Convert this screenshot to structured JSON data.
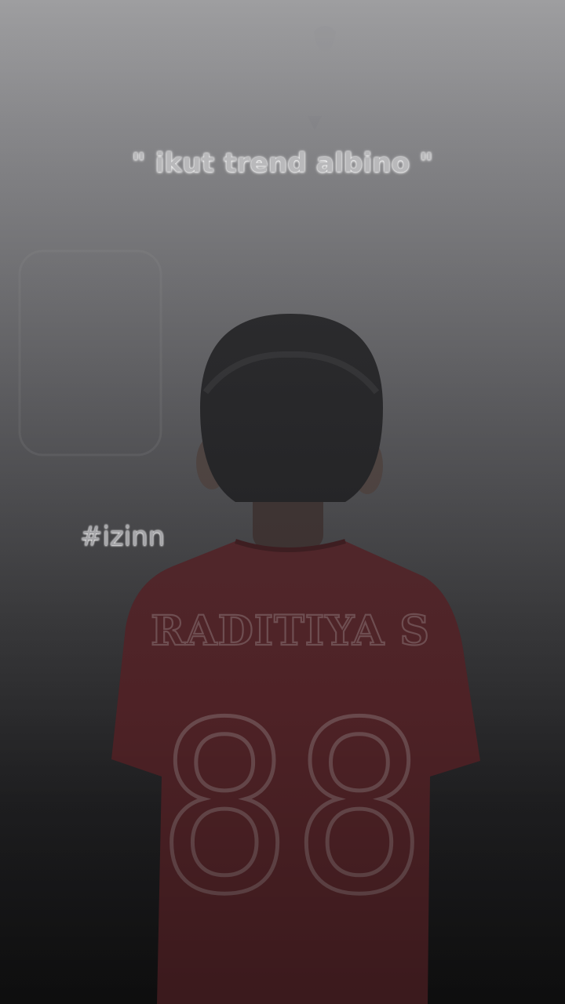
{
  "caption": "\" ikut trend albino \"",
  "hashtag": "#izinn",
  "jersey": {
    "name": "RADITIYA S",
    "number": "88"
  },
  "colors": {
    "background_top": "#9a9a9c",
    "background_bottom": "#121213",
    "jersey": "#5a2529",
    "hair": "#1b1b1d"
  }
}
